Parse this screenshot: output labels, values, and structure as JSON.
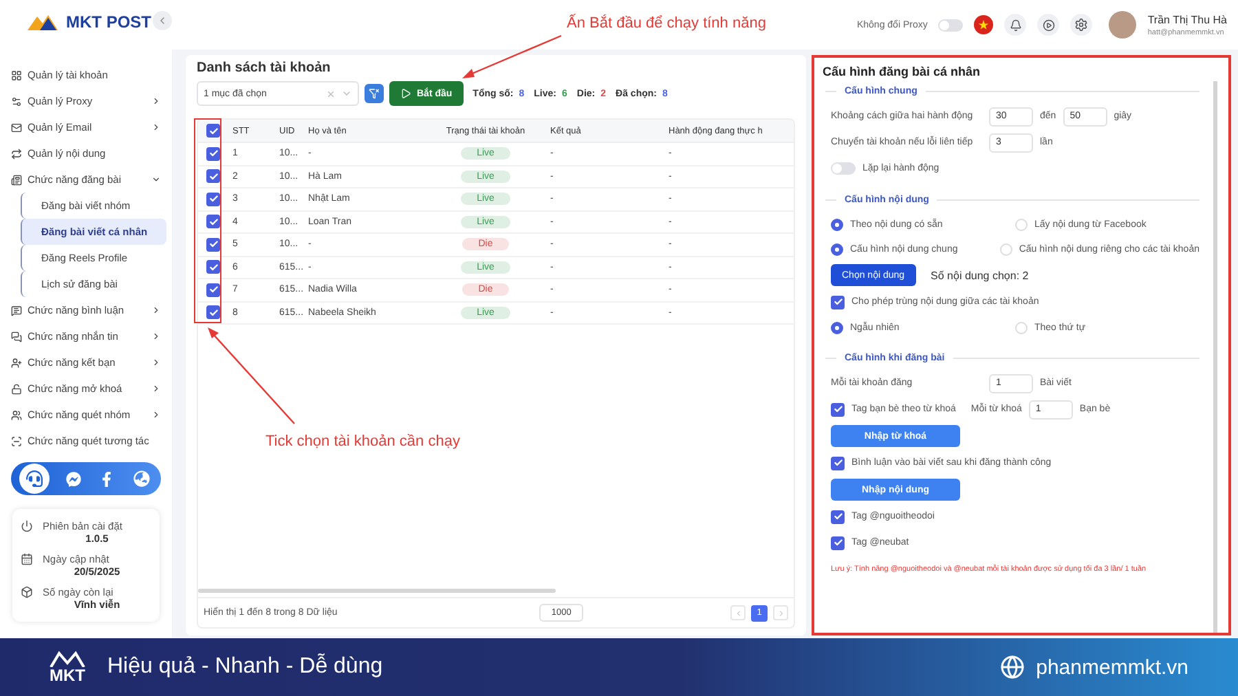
{
  "brand": {
    "name": "MKT POST"
  },
  "sidebar": {
    "items": [
      {
        "label": "Quản lý tài khoản",
        "selected": false
      },
      {
        "label": "Quản lý Proxy",
        "selected": false,
        "expanded": false
      },
      {
        "label": "Quản lý Email",
        "selected": false,
        "expanded": false
      },
      {
        "label": "Quản lý nội dung",
        "selected": false
      },
      {
        "label": "Chức năng đăng bài",
        "selected": false,
        "expanded": true,
        "children": [
          {
            "label": "Đăng bài viết nhóm",
            "selected": false
          },
          {
            "label": "Đăng bài viết cá nhân",
            "selected": true
          },
          {
            "label": "Đăng Reels Profile",
            "selected": false
          },
          {
            "label": "Lịch sử đăng bài",
            "selected": false
          }
        ]
      },
      {
        "label": "Chức năng bình luận",
        "selected": false,
        "expanded": false
      },
      {
        "label": "Chức năng nhắn tin",
        "selected": false,
        "expanded": false
      },
      {
        "label": "Chức năng kết bạn",
        "selected": false,
        "expanded": false
      },
      {
        "label": "Chức năng mở khoá",
        "selected": false,
        "expanded": false
      },
      {
        "label": "Chức năng quét nhóm",
        "selected": false,
        "expanded": false
      },
      {
        "label": "Chức năng quét tương tác",
        "selected": false
      }
    ],
    "info": [
      {
        "label": "Phiên bản cài đặt",
        "value": "1.0.5"
      },
      {
        "label": "Ngày cập nhật",
        "value": "20/5/2025"
      },
      {
        "label": "Số ngày còn lại",
        "value": "Vĩnh viễn"
      }
    ]
  },
  "header": {
    "proxy_toggle": {
      "label": "Không đổi Proxy",
      "on": false
    },
    "user": {
      "name": "Trần Thị Thu Hà",
      "email": "hatt@phanmemmkt.vn"
    }
  },
  "accounts": {
    "title": "Danh sách tài khoản",
    "select": {
      "value": "1 mục đã chọn"
    },
    "start_button": "Bắt đầu",
    "stats": [
      {
        "label": "Tổng số:",
        "value": "8",
        "color": "#4f63e8"
      },
      {
        "label": "Live:",
        "value": "6",
        "color": "#3c9a55"
      },
      {
        "label": "Die:",
        "value": "2",
        "color": "#e04848"
      },
      {
        "label": "Đã chọn:",
        "value": "8",
        "color": "#4f63e8"
      }
    ],
    "columns": [
      "STT",
      "UID",
      "Họ và tên",
      "Trạng thái tài khoản",
      "Kết quả",
      "Hành động đang thực h"
    ],
    "all_checked": true,
    "rows": [
      {
        "stt": "1",
        "uid": "10...",
        "name": "-",
        "status": {
          "label": "Live",
          "color": "#3c9a55"
        },
        "result": "-",
        "action": "-",
        "checked": true
      },
      {
        "stt": "2",
        "uid": "10...",
        "name": "Hà Lam",
        "status": {
          "label": "Live",
          "color": "#3c9a55"
        },
        "result": "-",
        "action": "-",
        "checked": true
      },
      {
        "stt": "3",
        "uid": "10...",
        "name": "Nhật Lam",
        "status": {
          "label": "Live",
          "color": "#3c9a55"
        },
        "result": "-",
        "action": "-",
        "checked": true
      },
      {
        "stt": "4",
        "uid": "10...",
        "name": "Loan Tran",
        "status": {
          "label": "Live",
          "color": "#3c9a55"
        },
        "result": "-",
        "action": "-",
        "checked": true
      },
      {
        "stt": "5",
        "uid": "10...",
        "name": "-",
        "status": {
          "label": "Die",
          "color": "#d24c4c"
        },
        "result": "-",
        "action": "-",
        "checked": true
      },
      {
        "stt": "6",
        "uid": "615...",
        "name": "-",
        "status": {
          "label": "Live",
          "color": "#3c9a55"
        },
        "result": "-",
        "action": "-",
        "checked": true
      },
      {
        "stt": "7",
        "uid": "615...",
        "name": "Nadia Willa",
        "status": {
          "label": "Die",
          "color": "#d24c4c"
        },
        "result": "-",
        "action": "-",
        "checked": true
      },
      {
        "stt": "8",
        "uid": "615...",
        "name": "Nabeela Sheikh",
        "status": {
          "label": "Live",
          "color": "#3c9a55"
        },
        "result": "-",
        "action": "-",
        "checked": true
      }
    ],
    "footer": {
      "summary": "Hiển thị 1 đến 8 trong 8 Dữ liệu",
      "page_size": "1000",
      "pages": [
        {
          "label": "1",
          "selected": true
        }
      ]
    }
  },
  "config": {
    "title": "Cấu hình đăng bài cá nhân",
    "sections": [
      {
        "title": "Cấu hình chung",
        "rows": [
          {
            "kind": "range",
            "label": "Khoảng cách giữa hai hành động",
            "from": "30",
            "sep": "đến",
            "to": "50",
            "unit": "giây"
          },
          {
            "kind": "number",
            "label": "Chuyển tài khoản nếu lỗi liên tiếp",
            "value": "3",
            "unit": "lần"
          },
          {
            "kind": "toggle",
            "label": "Lặp lại hành động",
            "on": false
          }
        ]
      },
      {
        "title": "Cấu hình nội dung",
        "rows": [
          {
            "kind": "radios",
            "options": [
              {
                "label": "Theo nội dung có sẵn",
                "selected": true
              },
              {
                "label": "Lấy nội dung từ Facebook",
                "selected": false
              }
            ]
          },
          {
            "kind": "radios",
            "options": [
              {
                "label": "Cấu hình nội dung chung",
                "selected": true
              },
              {
                "label": "Cấu hình nội dung riêng cho các tài khoản",
                "selected": false
              }
            ]
          },
          {
            "kind": "pick",
            "label": "Chọn nội dung",
            "caption": "Số nội dung chọn: 2"
          },
          {
            "kind": "check",
            "label": "Cho phép trùng nội dung giữa các tài khoản",
            "checked": true
          },
          {
            "kind": "radios",
            "options": [
              {
                "label": "Ngẫu nhiên",
                "selected": true
              },
              {
                "label": "Theo thứ tự",
                "selected": false
              }
            ]
          }
        ]
      },
      {
        "title": "Cấu hình khi đăng bài",
        "rows": [
          {
            "kind": "number",
            "label": "Mỗi tài khoản đăng",
            "value": "1",
            "unit": "Bài viết"
          },
          {
            "kind": "check",
            "label": "Tag bạn bè theo từ khoá",
            "checked": true,
            "extra": {
              "label": "Mỗi từ khoá",
              "value": "1",
              "unit": "Bạn bè"
            }
          },
          {
            "kind": "wide",
            "label": "Nhập từ khoá"
          },
          {
            "kind": "check",
            "label": "Bình luận vào bài viết sau khi đăng thành công",
            "checked": true
          },
          {
            "kind": "wide",
            "label": "Nhập nội dung"
          },
          {
            "kind": "check",
            "label": "Tag @nguoitheodoi",
            "checked": true
          },
          {
            "kind": "check",
            "label": "Tag @neubat",
            "checked": true
          },
          {
            "kind": "note",
            "text": "Lưu ý: Tính năng @nguoitheodoi và @neubat mỗi tài khoản được sử dụng tối đa 3 lần/ 1 tuần"
          }
        ]
      }
    ]
  },
  "annotations": [
    {
      "text": "Ấn Bắt đầu để chạy tính năng"
    },
    {
      "text": "Tick chọn tài khoản cần chạy"
    }
  ],
  "banner": {
    "logo": "MKT",
    "slogan": "Hiệu quả - Nhanh - Dễ dùng",
    "website": "phanmemmkt.vn"
  }
}
